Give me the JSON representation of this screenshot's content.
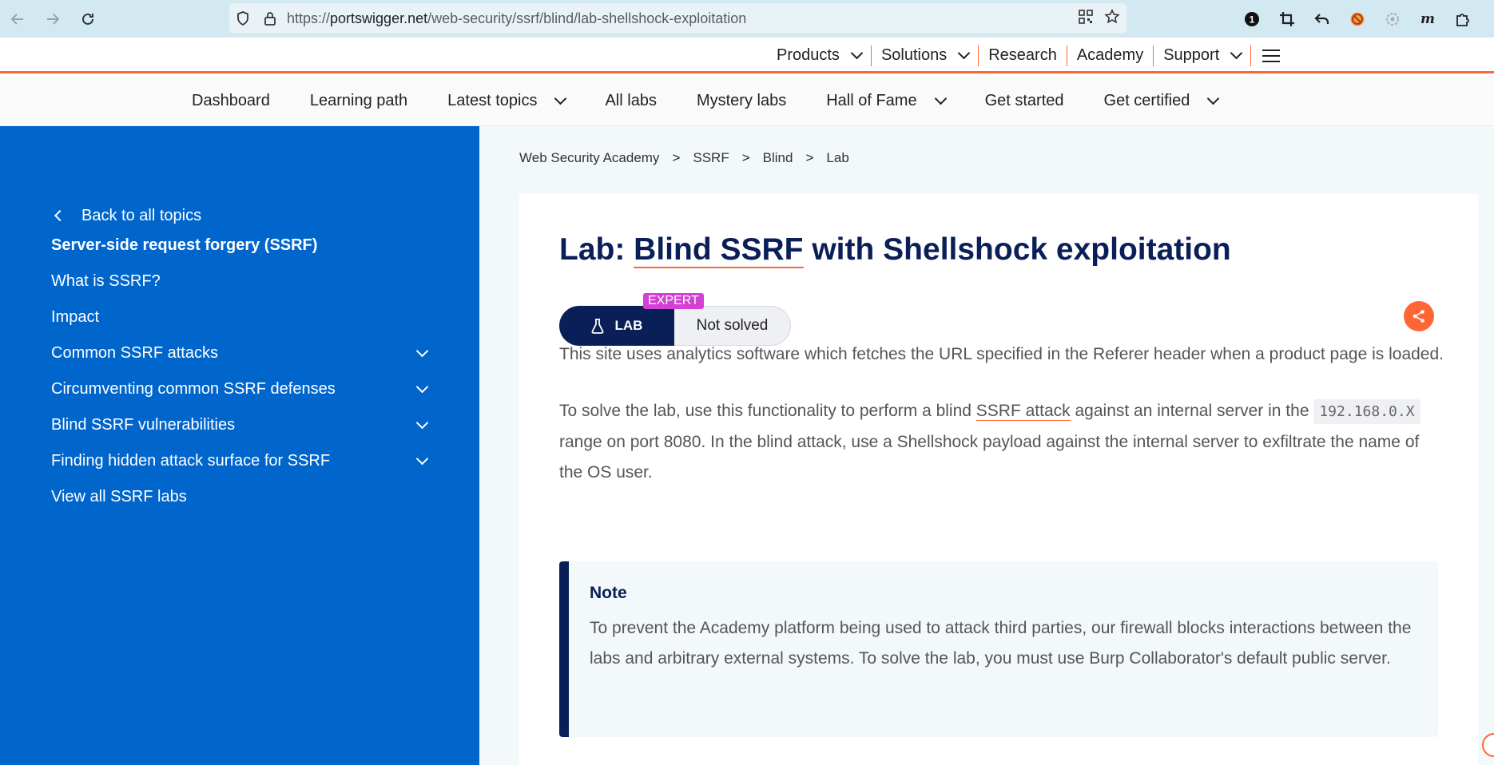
{
  "browser": {
    "url_prefix": "https://",
    "url_host": "portswigger.net",
    "url_path": "/web-security/ssrf/blind/lab-shellshock-exploitation"
  },
  "top_nav": {
    "items": [
      "Products",
      "Solutions",
      "Research",
      "Academy",
      "Support"
    ]
  },
  "sub_nav": {
    "items": [
      "Dashboard",
      "Learning path",
      "Latest topics",
      "All labs",
      "Mystery labs",
      "Hall of Fame",
      "Get started",
      "Get certified"
    ]
  },
  "sidebar": {
    "back": "Back to all topics",
    "items": [
      "Server-side request forgery (SSRF)",
      "What is SSRF?",
      "Impact",
      "Common SSRF attacks",
      "Circumventing common SSRF defenses",
      "Blind SSRF vulnerabilities",
      "Finding hidden attack surface for SSRF",
      "View all SSRF labs"
    ]
  },
  "breadcrumb": {
    "items": [
      "Web Security Academy",
      "SSRF",
      "Blind",
      "Lab"
    ],
    "separator": ">"
  },
  "lab": {
    "title_prefix": "Lab: ",
    "title_link": "Blind SSRF",
    "title_suffix": " with Shellshock exploitation",
    "badge": "LAB",
    "level": "EXPERT",
    "status": "Not solved",
    "para1": "This site uses analytics software which fetches the URL specified in the Referer header when a product page is loaded.",
    "para2_a": "To solve the lab, use this functionality to perform a blind ",
    "para2_link": "SSRF attack",
    "para2_b": " against an internal server in the ",
    "para2_code": "192.168.0.X",
    "para2_c": " range on port 8080. In the blind attack, use a Shellshock payload against the internal server to exfiltrate the name of the OS user."
  },
  "note": {
    "title": "Note",
    "body": "To prevent the Academy platform being used to attack third parties, our firewall blocks interactions between the labs and arbitrary external systems. To solve the lab, you must use Burp Collaborator's default public server."
  },
  "colors": {
    "sidebar": "#0066cc",
    "accent": "#ff6633",
    "navy": "#0a1f58",
    "expert": "#d43fd4"
  }
}
